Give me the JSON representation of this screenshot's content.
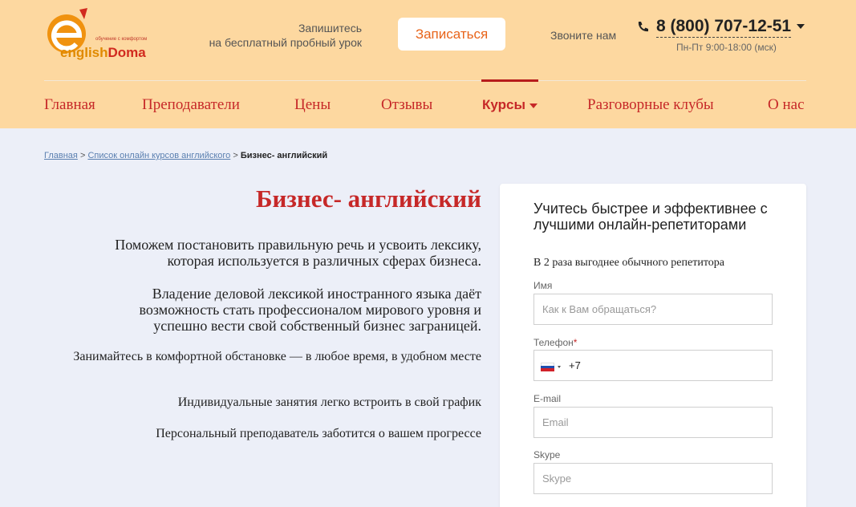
{
  "header": {
    "logo": {
      "tagline": "обучение с комфортом",
      "brand_english": "english",
      "brand_doma": "Doma"
    },
    "promo_line1": "Запишитесь",
    "promo_line2": "на бесплатный пробный урок",
    "signup_button": "Записаться",
    "call_label": "Звоните нам",
    "phone": "8 (800) 707-12-51",
    "hours": "Пн-Пт 9:00-18:00 (мск)",
    "colors": {
      "background": "#fdd8a0",
      "accent": "#c62828",
      "button_text": "#e8641a"
    }
  },
  "nav": {
    "items": [
      {
        "label": "Главная"
      },
      {
        "label": "Преподаватели"
      },
      {
        "label": "Цены"
      },
      {
        "label": "Отзывы"
      },
      {
        "label": "Курсы",
        "active": true
      },
      {
        "label": "Разговорные клубы"
      },
      {
        "label": "О нас"
      }
    ]
  },
  "breadcrumb": {
    "home": "Главная",
    "sep": ">",
    "list": "Список онлайн курсов английского",
    "current": "Бизнес- английский"
  },
  "main": {
    "title": "Бизнес- английский",
    "paragraphs": [
      "Поможем постановить правильную речь и усвоить лексику, которая используется в различных сферах бизнеса.",
      "Владение деловой лексикой иностранного языка даёт возможность стать профессионалом мирового уровня и успешно вести свой собственный бизнес заграницей.",
      "Занимайтесь в комфортной обстановке — в любое время, в удобном месте",
      "Индивидуальные занятия легко встроить в свой график",
      "Персональный преподаватель заботится о вашем прогрессе"
    ]
  },
  "form": {
    "heading": "Учитесь быстрее и эффективнее с лучшими онлайн-репетиторами",
    "subheading": "В 2 раза выгоднее обычного репетитора",
    "name_label": "Имя",
    "name_placeholder": "Как к Вам обращаться?",
    "phone_label": "Телефон",
    "phone_required_mark": "*",
    "phone_prefix": "+7",
    "email_label": "E-mail",
    "email_placeholder": "Email",
    "skype_label": "Skype",
    "skype_placeholder": "Skype"
  }
}
